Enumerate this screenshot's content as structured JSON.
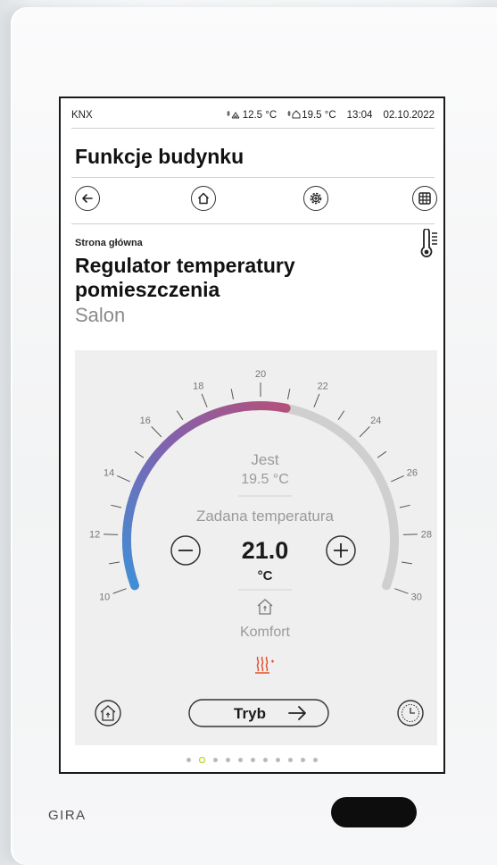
{
  "status": {
    "brand": "KNX",
    "outdoor_temp": "12.5 °C",
    "indoor_temp": "19.5 °C",
    "time": "13:04",
    "date": "02.10.2022"
  },
  "header": {
    "title": "Funkcje budynku"
  },
  "nav": {
    "buttons": [
      {
        "name": "back-arrow-icon"
      },
      {
        "name": "home-icon"
      },
      {
        "name": "settings-gear-icon"
      },
      {
        "name": "grid-icon"
      }
    ]
  },
  "page": {
    "breadcrumb": "Strona główna",
    "title_line1": "Regulator temperatury",
    "title_line2": "pomieszczenia",
    "room": "Salon"
  },
  "dial": {
    "min": 10,
    "max": 30,
    "tick_labels": [
      "10",
      "12",
      "14",
      "16",
      "18",
      "20",
      "22",
      "24",
      "26",
      "28",
      "30"
    ],
    "actual_label": "Jest",
    "actual_value": "19.5 °C",
    "setpoint_label": "Zadana temperatura",
    "setpoint_value": "21.0",
    "setpoint_unit": "°C",
    "setpoint_number": 21.0,
    "mode_label": "Komfort",
    "mode_button_label": "Tryb",
    "colors": {
      "cold": "#3f8fd6",
      "mid": "#8b5fa8",
      "warm": "#b4507a",
      "track": "#cfcfcf",
      "heating": "#e2502d"
    }
  },
  "pagination": {
    "count": 11,
    "active_index": 1
  },
  "device": {
    "brand": "GIRA"
  }
}
